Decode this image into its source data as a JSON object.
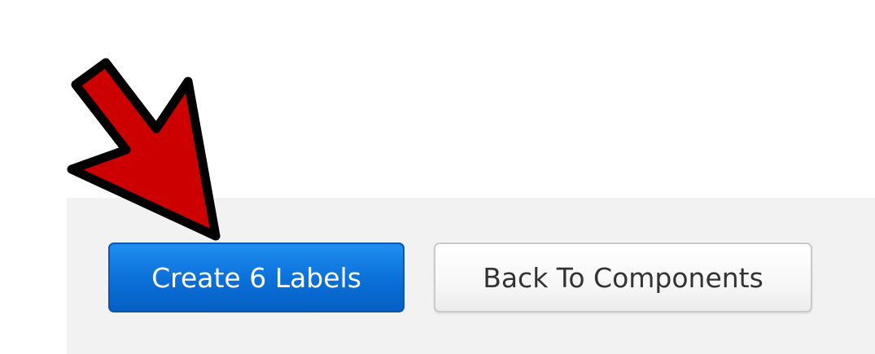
{
  "actions": {
    "primary_label": "Create 6 Labels",
    "secondary_label": "Back To Components"
  },
  "annotation": {
    "arrow_icon": "red-pointer-arrow-icon",
    "arrow_color": "#cc0000",
    "arrow_outline_color": "#000000"
  },
  "colors": {
    "primary_button": "#0a6fd8",
    "secondary_button": "#f7f7f7",
    "footer_background": "#f2f2f2"
  }
}
